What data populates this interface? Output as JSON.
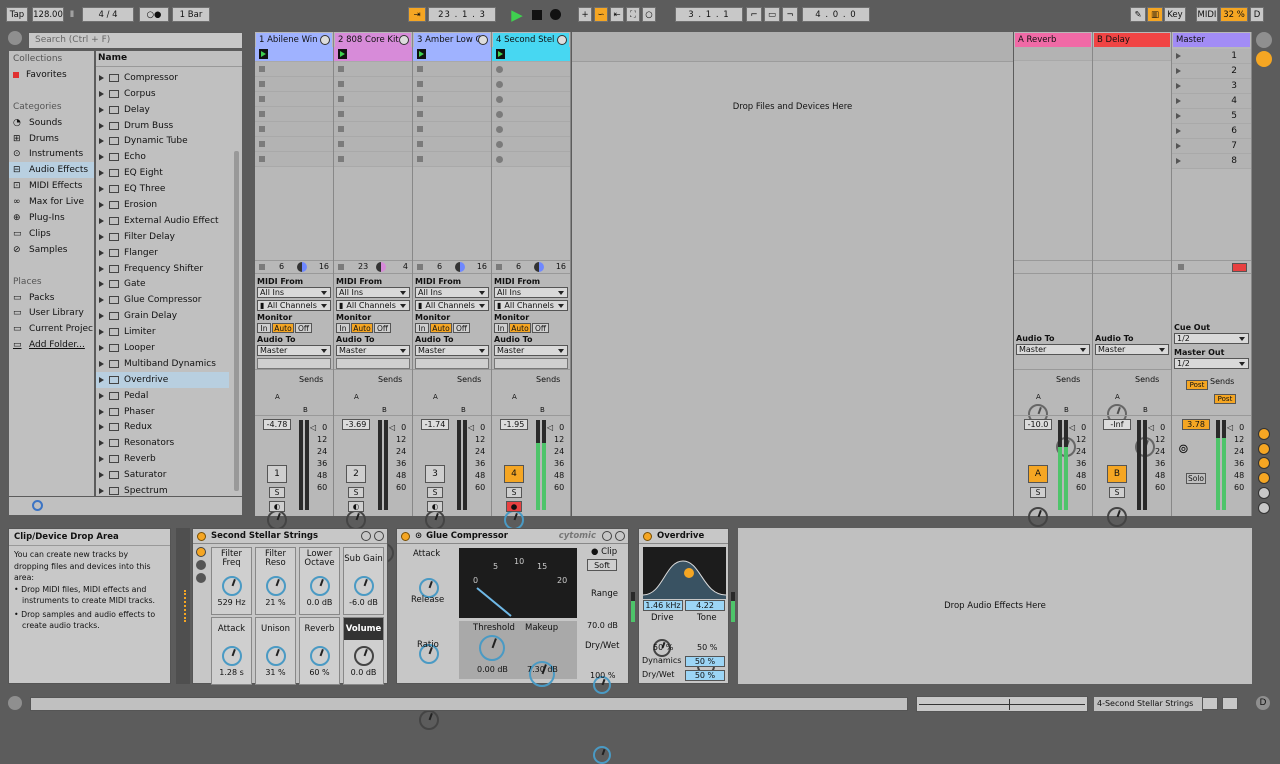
{
  "transport": {
    "tap": "Tap",
    "tempo": "128.00",
    "sig_num": "4",
    "sig_sep": "/",
    "sig_den": "4",
    "metro": "○●",
    "quant": "1 Bar",
    "position": "23 .  1 .  3",
    "loop_start": "3 .  1 .  1",
    "loop_len": "4 .  0 .  0",
    "key": "Key",
    "midi": "MIDI",
    "cpu": "32 %",
    "d": "D"
  },
  "browser": {
    "search_placeholder": "Search (Ctrl + F)",
    "collections_label": "Collections",
    "favorites": "Favorites",
    "categories_label": "Categories",
    "categories": [
      "Sounds",
      "Drums",
      "Instruments",
      "Audio Effects",
      "MIDI Effects",
      "Max for Live",
      "Plug-Ins",
      "Clips",
      "Samples"
    ],
    "places_label": "Places",
    "places": [
      "Packs",
      "User Library",
      "Current Projec",
      "Add Folder..."
    ],
    "name_header": "Name",
    "items": [
      "Compressor",
      "Corpus",
      "Delay",
      "Drum Buss",
      "Dynamic Tube",
      "Echo",
      "EQ Eight",
      "EQ Three",
      "Erosion",
      "External Audio Effect",
      "Filter Delay",
      "Flanger",
      "Frequency Shifter",
      "Gate",
      "Glue Compressor",
      "Grain Delay",
      "Limiter",
      "Looper",
      "Multiband Dynamics",
      "Overdrive",
      "Pedal",
      "Phaser",
      "Redux",
      "Resonators",
      "Reverb",
      "Saturator",
      "Spectrum"
    ],
    "selected": "Overdrive"
  },
  "tracks": [
    {
      "name": "1 Abilene Win",
      "color": "#9fb2ff",
      "num": "1",
      "vol": "-4.78",
      "a": "6",
      "b": "16",
      "armed": false
    },
    {
      "name": "2 808 Core Kit",
      "color": "#d78bd9",
      "num": "2",
      "vol": "-3.69",
      "a": "23",
      "b": "4",
      "armed": false
    },
    {
      "name": "3 Amber Low Gl",
      "color": "#9fb2ff",
      "num": "3",
      "vol": "-1.74",
      "a": "6",
      "b": "16",
      "armed": false
    },
    {
      "name": "4 Second Stel",
      "color": "#47d7f2",
      "num": "4",
      "vol": "-1.95",
      "a": "6",
      "b": "16",
      "armed": true
    }
  ],
  "io": {
    "midi_from": "MIDI From",
    "all_ins": "All Ins",
    "all_channels": "All Channels",
    "monitor": "Monitor",
    "in": "In",
    "auto": "Auto",
    "off": "Off",
    "audio_to": "Audio To",
    "master": "Master",
    "sends": "Sends",
    "send_a": "A",
    "send_b": "B",
    "solo": "S"
  },
  "returns": [
    {
      "name": "A Reverb",
      "color": "#f06aa6",
      "btn": "A",
      "vol": "-10.0"
    },
    {
      "name": "B Delay",
      "color": "#f04444",
      "btn": "B",
      "vol": "-Inf"
    }
  ],
  "master": {
    "name": "Master",
    "scenes": [
      "1",
      "2",
      "3",
      "4",
      "5",
      "6",
      "7",
      "8"
    ],
    "cue_out": "Cue Out",
    "cue_val": "1/2",
    "master_out": "Master Out",
    "master_val": "1/2",
    "post": "Post",
    "vol": "3.78",
    "solo": "Solo"
  },
  "drop_files": "Drop Files and Devices Here",
  "meter_scale": [
    "0",
    "12",
    "24",
    "36",
    "48",
    "60"
  ],
  "info": {
    "title": "Clip/Device Drop Area",
    "p1": "You can create new tracks by dropping files and devices into this area:",
    "b1": "Drop MIDI files, MIDI effects and instruments to create MIDI tracks.",
    "b2": "Drop samples and audio effects to create audio tracks."
  },
  "rack": {
    "name": "Second Stellar Strings",
    "macros": [
      {
        "label": "Filter Freq",
        "value": "529 Hz"
      },
      {
        "label": "Filter Reso",
        "value": "21 %"
      },
      {
        "label": "Lower Octave",
        "value": "0.0 dB"
      },
      {
        "label": "Sub Gain",
        "value": "-6.0 dB"
      },
      {
        "label": "Attack",
        "value": "1.28 s"
      },
      {
        "label": "Unison",
        "value": "31 %"
      },
      {
        "label": "Reverb",
        "value": "60 %"
      },
      {
        "label": "Volume",
        "value": "0.0 dB"
      }
    ]
  },
  "glue": {
    "name": "Glue Compressor",
    "brand": "cytomic",
    "attack": "Attack",
    "release": "Release",
    "ratio": "Ratio",
    "clip": "Clip",
    "soft": "Soft",
    "threshold": "Threshold",
    "threshold_val": "0.00 dB",
    "makeup": "Makeup",
    "makeup_val": "7.30 dB",
    "range": "Range",
    "range_val": "70.0 dB",
    "drywet": "Dry/Wet",
    "drywet_val": "100 %",
    "vu": [
      "0",
      "5",
      "10",
      "15",
      "20"
    ]
  },
  "overdrive": {
    "name": "Overdrive",
    "freq": "1.46 kHz",
    "width": "4.22",
    "drive": "Drive",
    "drive_val": "50 %",
    "tone": "Tone",
    "tone_val": "50 %",
    "dynamics": "Dynamics",
    "dyn_val": "50 %",
    "drywet": "Dry/Wet",
    "drywet_val": "50 %"
  },
  "drop_effects": "Drop Audio Effects Here",
  "status": {
    "track": "4-Second Stellar Strings"
  }
}
